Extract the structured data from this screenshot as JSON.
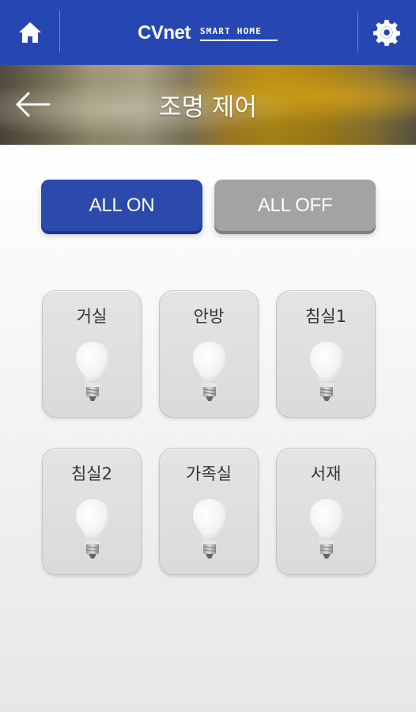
{
  "header": {
    "brand": "CVnet",
    "tagline": "SMART HOME",
    "home_icon": "home-icon",
    "settings_icon": "gear-icon",
    "accent_color": "#2647b2"
  },
  "page": {
    "title": "조명 제어",
    "back_icon": "back-arrow-icon"
  },
  "controls": {
    "all_on_label": "ALL ON",
    "all_off_label": "ALL OFF"
  },
  "rooms": [
    {
      "label": "거실",
      "icon": "light-bulb-icon"
    },
    {
      "label": "안방",
      "icon": "light-bulb-icon"
    },
    {
      "label": "침실1",
      "icon": "light-bulb-icon"
    },
    {
      "label": "침실2",
      "icon": "light-bulb-icon"
    },
    {
      "label": "가족실",
      "icon": "light-bulb-icon"
    },
    {
      "label": "서재",
      "icon": "light-bulb-icon"
    }
  ]
}
